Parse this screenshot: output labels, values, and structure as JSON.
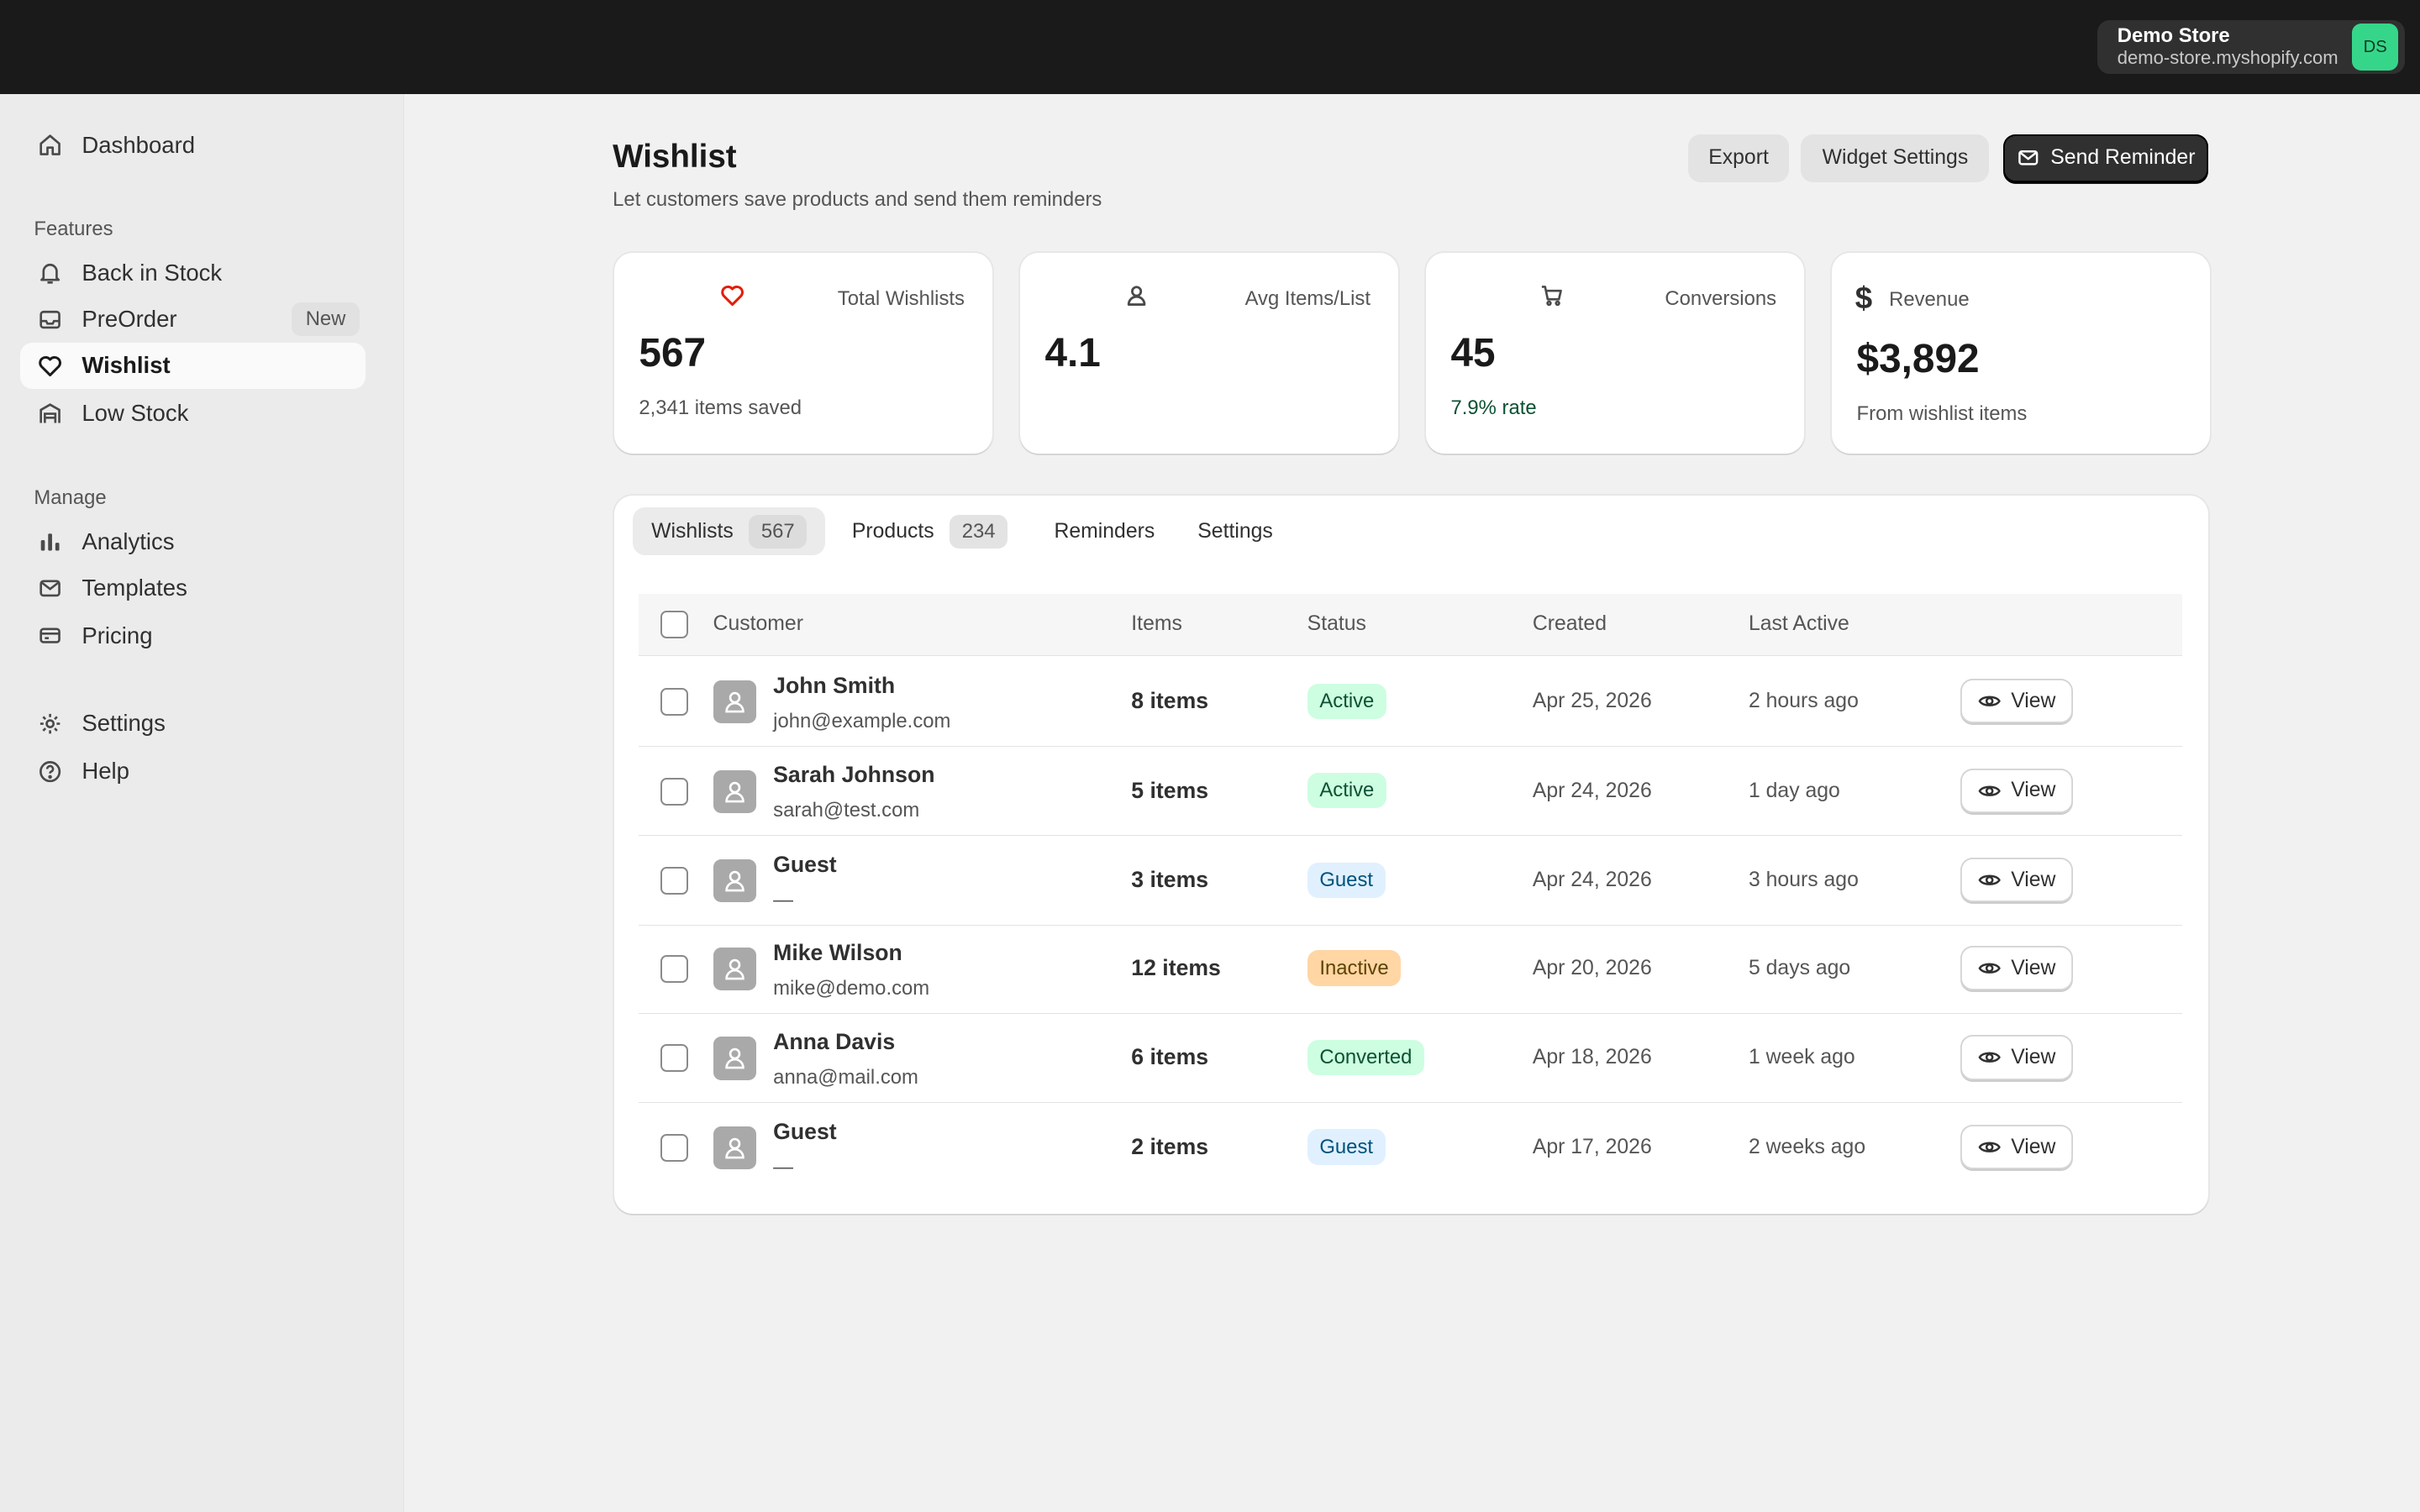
{
  "store": {
    "name": "Demo Store",
    "domain": "demo-store.myshopify.com",
    "initials": "DS"
  },
  "nav": {
    "dashboard": "Dashboard",
    "features_heading": "Features",
    "back_in_stock": "Back in Stock",
    "preorder": "PreOrder",
    "preorder_badge": "New",
    "wishlist": "Wishlist",
    "low_stock": "Low Stock",
    "manage_heading": "Manage",
    "analytics": "Analytics",
    "templates": "Templates",
    "pricing": "Pricing",
    "settings": "Settings",
    "help": "Help"
  },
  "header": {
    "title": "Wishlist",
    "subtitle": "Let customers save products and send them reminders",
    "export": "Export",
    "widget_settings": "Widget Settings",
    "send_reminder": "Send Reminder"
  },
  "stats": [
    {
      "label": "Total Wishlists",
      "value": "567",
      "sub": "2,341 items saved",
      "icon": "heart-icon"
    },
    {
      "label": "Avg Items/List",
      "value": "4.1",
      "sub": "",
      "icon": "person-icon"
    },
    {
      "label": "Conversions",
      "value": "45",
      "sub": "7.9% rate",
      "icon": "cart-icon"
    },
    {
      "label": "Revenue",
      "value": "$3,892",
      "sub": "From wishlist items",
      "icon": "dollar-icon"
    }
  ],
  "tabs": [
    {
      "label": "Wishlists",
      "count": "567"
    },
    {
      "label": "Products",
      "count": "234"
    },
    {
      "label": "Reminders"
    },
    {
      "label": "Settings"
    }
  ],
  "table": {
    "headers": {
      "customer": "Customer",
      "items": "Items",
      "status": "Status",
      "created": "Created",
      "last_active": "Last Active"
    },
    "view_label": "View",
    "rows": [
      {
        "name": "John Smith",
        "email": "john@example.com",
        "items": "8 items",
        "status": "Active",
        "created": "Apr 25, 2026",
        "last_active": "2 hours ago"
      },
      {
        "name": "Sarah Johnson",
        "email": "sarah@test.com",
        "items": "5 items",
        "status": "Active",
        "created": "Apr 24, 2026",
        "last_active": "1 day ago"
      },
      {
        "name": "Guest",
        "email": "—",
        "items": "3 items",
        "status": "Guest",
        "created": "Apr 24, 2026",
        "last_active": "3 hours ago"
      },
      {
        "name": "Mike Wilson",
        "email": "mike@demo.com",
        "items": "12 items",
        "status": "Inactive",
        "created": "Apr 20, 2026",
        "last_active": "5 days ago"
      },
      {
        "name": "Anna Davis",
        "email": "anna@mail.com",
        "items": "6 items",
        "status": "Converted",
        "created": "Apr 18, 2026",
        "last_active": "1 week ago"
      },
      {
        "name": "Guest",
        "email": "—",
        "items": "2 items",
        "status": "Guest",
        "created": "Apr 17, 2026",
        "last_active": "2 weeks ago"
      }
    ]
  },
  "colors": {
    "active_bg": "#cdfee1",
    "active_fg": "#0c5132",
    "guest_bg": "#e0f0ff",
    "guest_fg": "#00527c",
    "inactive_bg": "#ffd6a4",
    "inactive_fg": "#5e4200",
    "converted_bg": "#cdfee1",
    "converted_fg": "#0c5132",
    "heart": "#e51c00",
    "rate": "#0c5132"
  }
}
